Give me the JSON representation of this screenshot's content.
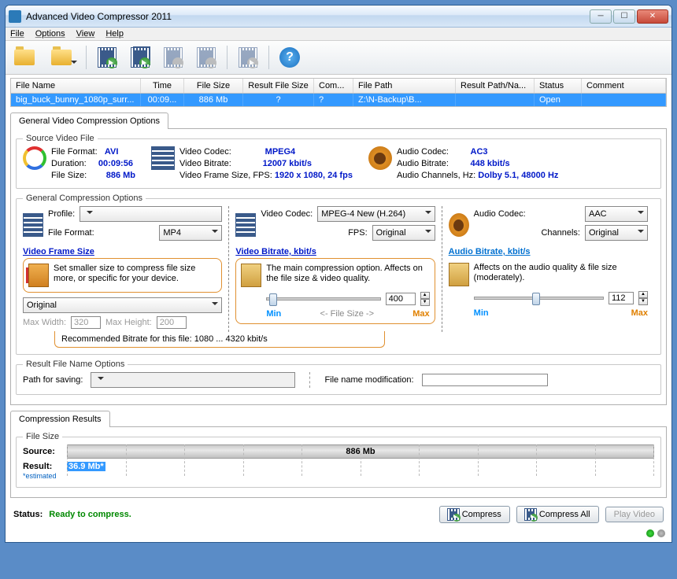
{
  "window": {
    "title": "Advanced Video Compressor 2011"
  },
  "menu": {
    "file": "File",
    "options": "Options",
    "view": "View",
    "help": "Help"
  },
  "grid": {
    "headers": {
      "filename": "File Name",
      "time": "Time",
      "filesize": "File Size",
      "resultsize": "Result File Size",
      "com": "Com...",
      "filepath": "File Path",
      "resultpath": "Result Path/Na...",
      "status": "Status",
      "comment": "Comment"
    },
    "row": {
      "filename": "big_buck_bunny_1080p_surr...",
      "time": "00:09...",
      "filesize": "886 Mb",
      "resultsize": "?",
      "com": "?",
      "filepath": "Z:\\N-Backup\\B...",
      "resultpath": "",
      "status": "Open",
      "comment": ""
    }
  },
  "tab": {
    "label": "General Video Compression Options"
  },
  "source": {
    "legend": "Source Video File",
    "fileformat_l": "File Format:",
    "fileformat_v": "AVI",
    "duration_l": "Duration:",
    "duration_v": "00:09:56",
    "filesize_l": "File Size:",
    "filesize_v": "886 Mb",
    "vcodec_l": "Video Codec:",
    "vcodec_v": "MPEG4",
    "vbitrate_l": "Video Bitrate:",
    "vbitrate_v": "12007 kbit/s",
    "vframe_l": "Video Frame Size, FPS:",
    "vframe_v": "1920 x 1080, 24 fps",
    "acodec_l": "Audio Codec:",
    "acodec_v": "AC3",
    "abitrate_l": "Audio Bitrate:",
    "abitrate_v": "448 kbit/s",
    "achan_l": "Audio Channels, Hz:",
    "achan_v": "Dolby 5.1, 48000 Hz"
  },
  "gco": {
    "legend": "General Compression Options",
    "profile_l": "Profile:",
    "format_l": "File Format:",
    "format_v": "MP4",
    "vfs_head": "Video Frame Size",
    "vfs_help": "Set smaller size to compress file size more, or specific for your device.",
    "vfs_combo": "Original",
    "maxw_l": "Max Width:",
    "maxw_v": "320",
    "maxh_l": "Max Height:",
    "maxh_v": "200",
    "vcodec_l": "Video Codec:",
    "vcodec_v": "MPEG-4 New (H.264)",
    "fps_l": "FPS:",
    "fps_v": "Original",
    "vbr_head": "Video Bitrate, kbit/s",
    "vbr_help": "The main compression option. Affects on the file size & video quality.",
    "vbr_val": "400",
    "min": "Min",
    "max": "Max",
    "filesize_hint": "<-  File Size  ->",
    "acodec_l": "Audio Codec:",
    "acodec_v": "AAC",
    "chan_l": "Channels:",
    "chan_v": "Original",
    "abr_head": "Audio Bitrate, kbit/s",
    "abr_help": "Affects on the audio quality & file size (moderately).",
    "abr_val": "112",
    "reco": "Recommended Bitrate for this file: 1080 ... 4320 kbit/s"
  },
  "resultopts": {
    "legend": "Result File Name Options",
    "path_l": "Path for saving:",
    "mod_l": "File name modification:"
  },
  "results": {
    "tab": "Compression Results",
    "legend": "File Size",
    "source_l": "Source:",
    "source_v": "886 Mb",
    "result_l": "Result:",
    "result_v": "36.9 Mb*",
    "est": "*estimated"
  },
  "status": {
    "label": "Status:",
    "text": "Ready to compress.",
    "compress": "Compress",
    "compress_all": "Compress All",
    "play": "Play Video"
  }
}
